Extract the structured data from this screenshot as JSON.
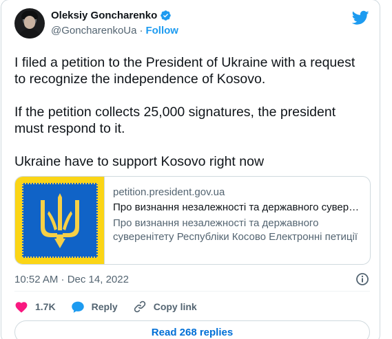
{
  "author": {
    "name": "Oleksiy Goncharenko",
    "handle": "@GoncharenkoUa",
    "separator": "·",
    "follow_label": "Follow"
  },
  "tweet": {
    "paragraphs": [
      "I filed a petition to the President of Ukraine with a request\nto recognize the independence of Kosovo.",
      "If the petition collects 25,000 signatures, the president\nmust respond to it.",
      "Ukraine have to support Kosovo right now"
    ]
  },
  "link_card": {
    "domain": "petition.president.gov.ua",
    "title": "Про визнання незалежності та державного суверенітету Республіки Косово",
    "description": "Про визнання незалежності та державного суверенітету Республіки Косово Електронні петиції"
  },
  "meta": {
    "timestamp": "10:52 AM · Dec 14, 2022"
  },
  "actions": {
    "likes": "1.7K",
    "reply_label": "Reply",
    "copy_link_label": "Copy link"
  },
  "read_replies_label": "Read 268 replies",
  "icons": {
    "verified": "verified-badge-icon",
    "brand": "twitter-bird-icon",
    "info": "info-icon",
    "like": "heart-icon",
    "reply": "speech-bubble-icon",
    "copy": "link-icon"
  },
  "colors": {
    "accent": "#1d9bf0",
    "like": "#f91880",
    "secondary_text": "#536471",
    "primary_text": "#0f1419",
    "thumbnail_blue": "#1063c7",
    "thumbnail_gold": "#fbd516"
  }
}
